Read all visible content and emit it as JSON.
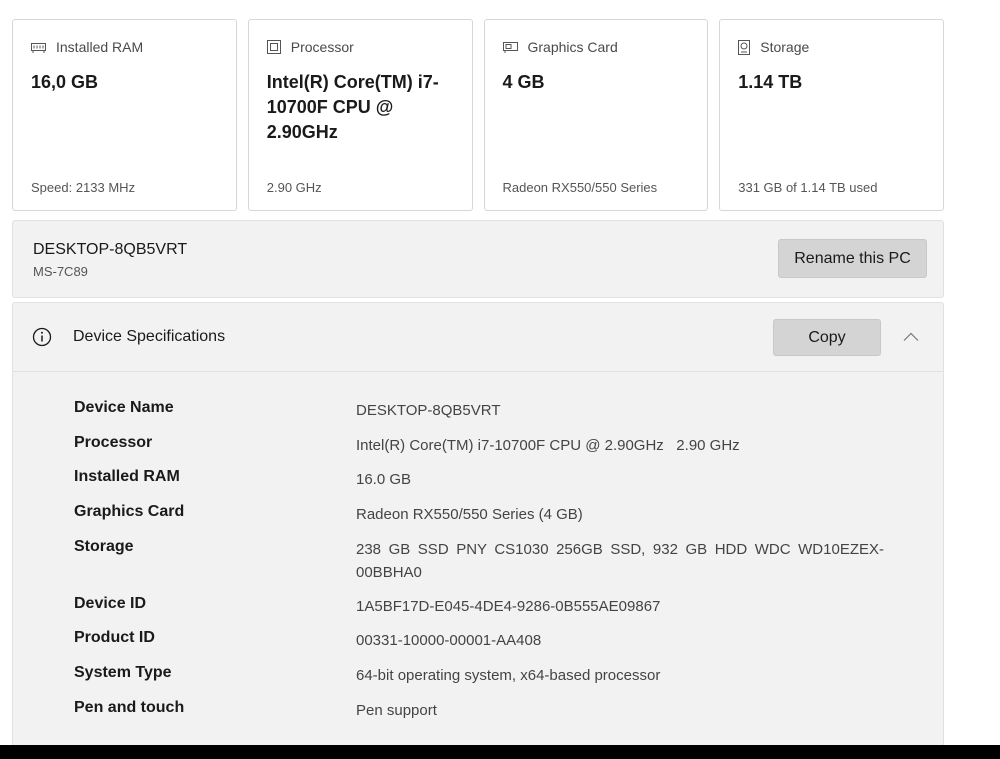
{
  "cards": [
    {
      "title": "Installed RAM",
      "icon": "ram-icon",
      "value": "16,0 GB",
      "footer": "Speed: 2133 MHz"
    },
    {
      "title": "Processor",
      "icon": "processor-icon",
      "value": "Intel(R) Core(TM) i7-10700F CPU @ 2.90GHz",
      "footer": "2.90 GHz"
    },
    {
      "title": "Graphics Card",
      "icon": "graphics-card-icon",
      "value": "4 GB",
      "footer": "Radeon RX550/550 Series"
    },
    {
      "title": "Storage",
      "icon": "storage-icon",
      "value": "1.14 TB",
      "footer": "331 GB of 1.14 TB used"
    }
  ],
  "device": {
    "name": "DESKTOP-8QB5VRT",
    "model": "MS-7C89",
    "rename_label": "Rename this PC"
  },
  "specs": {
    "title": "Device Specifications",
    "copy_label": "Copy",
    "info_icon": "info-icon",
    "collapse_icon": "chevron-up-icon",
    "rows": [
      {
        "label": "Device Name",
        "value": "DESKTOP-8QB5VRT"
      },
      {
        "label": "Processor",
        "value": "Intel(R) Core(TM) i7-10700F CPU @ 2.90GHz   2.90 GHz"
      },
      {
        "label": "Installed RAM",
        "value": "16.0 GB"
      },
      {
        "label": "Graphics Card",
        "value": "Radeon RX550/550 Series (4 GB)"
      },
      {
        "label": "Storage",
        "value": "238 GB SSD PNY CS1030 256GB SSD, 932 GB HDD WDC WD10EZEX-00BBHA0"
      },
      {
        "label": "Device ID",
        "value": "1A5BF17D-E045-4DE4-9286-0B555AE09867"
      },
      {
        "label": "Product ID",
        "value": "00331-10000-00001-AA408"
      },
      {
        "label": "System Type",
        "value": "64-bit operating system, x64-based processor"
      },
      {
        "label": "Pen and touch",
        "value": "Pen support"
      }
    ]
  }
}
